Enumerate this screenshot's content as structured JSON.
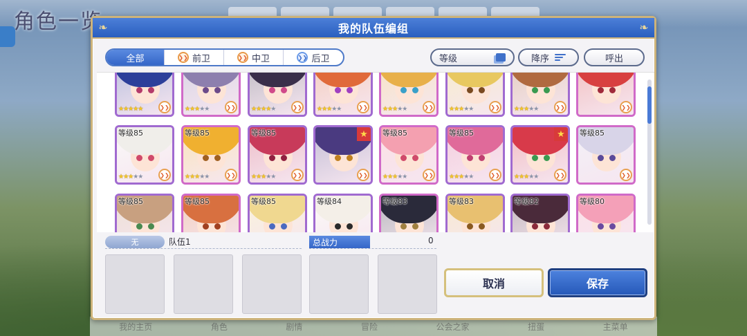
{
  "background": {
    "title": "角色一览",
    "bottom_nav": [
      "我的主页",
      "角色",
      "剧情",
      "冒险",
      "公会之家",
      "扭蛋",
      "主菜单"
    ]
  },
  "dialog": {
    "title": "我的队伍编组",
    "filters": [
      {
        "label": "全部",
        "active": true
      },
      {
        "label": "前卫",
        "active": false
      },
      {
        "label": "中卫",
        "active": false
      },
      {
        "label": "后卫",
        "active": false
      }
    ],
    "sort_level_label": "等级",
    "sort_order_label": "降序",
    "call_label": "呼出"
  },
  "characters": [
    {
      "level": "",
      "stars": 5,
      "hair": "#2c3f9a",
      "eye": "#b33a6a",
      "badge": false
    },
    {
      "level": "",
      "stars": 3,
      "hair": "#8d7fae",
      "eye": "#6c4a8a",
      "badge": false
    },
    {
      "level": "",
      "stars": 4,
      "hair": "#3a2f4a",
      "eye": "#d04a8a",
      "badge": false
    },
    {
      "level": "",
      "stars": 3,
      "hair": "#e06a3a",
      "eye": "#a040c0",
      "badge": false
    },
    {
      "level": "",
      "stars": 3,
      "hair": "#e8b04a",
      "eye": "#3aa0c8",
      "badge": false
    },
    {
      "level": "",
      "stars": 3,
      "hair": "#e8c860",
      "eye": "#7a4a20",
      "badge": false
    },
    {
      "level": "",
      "stars": 3,
      "hair": "#b06a40",
      "eye": "#3a9a50",
      "badge": false
    },
    {
      "level": "",
      "stars": 0,
      "hair": "#d84040",
      "eye": "#a02a3a",
      "badge": false
    },
    {
      "level": "等级85",
      "stars": 3,
      "hair": "#f0eeea",
      "eye": "#d04a6a",
      "badge": false
    },
    {
      "level": "等级85",
      "stars": 3,
      "hair": "#f0b030",
      "eye": "#a06020",
      "badge": false
    },
    {
      "level": "等级85",
      "stars": 3,
      "hair": "#c83a5a",
      "eye": "#902040",
      "badge": false
    },
    {
      "level": "",
      "stars": 0,
      "hair": "#4a3a80",
      "eye": "#c08020",
      "badge": true
    },
    {
      "level": "等级85",
      "stars": 3,
      "hair": "#f4a0b0",
      "eye": "#d04a6a",
      "badge": false
    },
    {
      "level": "等级85",
      "stars": 3,
      "hair": "#e06a9a",
      "eye": "#c04070",
      "badge": false
    },
    {
      "level": "",
      "stars": 3,
      "hair": "#d83a4a",
      "eye": "#3a9a50",
      "badge": true
    },
    {
      "level": "等级85",
      "stars": 0,
      "hair": "#d8d4e8",
      "eye": "#5a4a9a",
      "badge": false
    },
    {
      "level": "等级85",
      "stars": 0,
      "hair": "#c8a080",
      "eye": "#4a8a50",
      "badge": false
    },
    {
      "level": "等级85",
      "stars": 0,
      "hair": "#d87040",
      "eye": "#a04020",
      "badge": false
    },
    {
      "level": "等级85",
      "stars": 0,
      "hair": "#f0d890",
      "eye": "#4a6ac0",
      "badge": false
    },
    {
      "level": "等级84",
      "stars": 0,
      "hair": "#f4efe8",
      "eye": "#2a2a2a",
      "badge": false
    },
    {
      "level": "等级83",
      "stars": 0,
      "hair": "#2a2a3a",
      "eye": "#a08040",
      "badge": false
    },
    {
      "level": "等级83",
      "stars": 0,
      "hair": "#e8c070",
      "eye": "#8a5a20",
      "badge": false
    },
    {
      "level": "等级82",
      "stars": 0,
      "hair": "#4a2a3a",
      "eye": "#8a2a3a",
      "badge": false
    },
    {
      "level": "等级80",
      "stars": 0,
      "hair": "#f4a0b8",
      "eye": "#6a4aa0",
      "badge": false
    }
  ],
  "party": {
    "name_pill": "无",
    "name": "队伍1",
    "power_label": "总战力",
    "power_value": "0"
  },
  "buttons": {
    "cancel": "取消",
    "save": "保存"
  }
}
